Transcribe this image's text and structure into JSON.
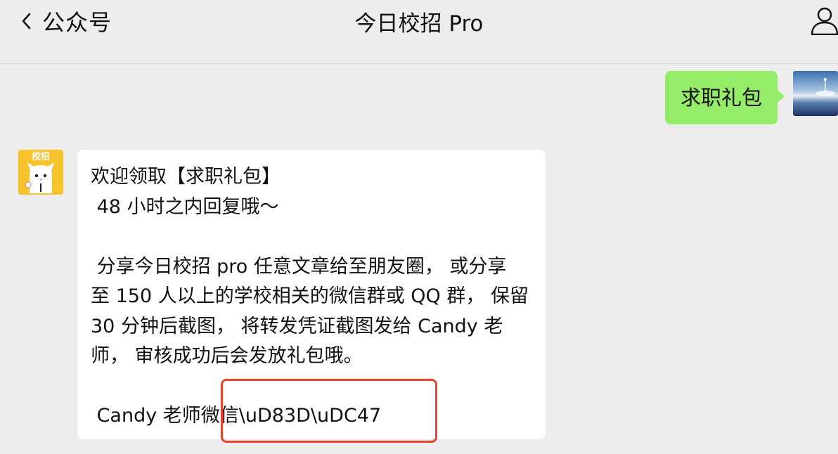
{
  "navbar": {
    "back_label": "公众号",
    "title": "今日校招 Pro"
  },
  "messages": {
    "outgoing_text": "求职礼包",
    "incoming_lines": [
      "欢迎领取【求职礼包】",
      " 48 小时之内回复哦～",
      "",
      " 分享今日校招 pro 任意文章给至朋友圈， 或分享",
      "至 150 人以上的学校相关的微信群或 QQ 群， 保留",
      "30 分钟后截图， 将转发凭证截图发给 Candy 老",
      "师， 审核成功后会发放礼包哦。",
      "",
      " Candy 老师微信\\uD83D\\uDC47"
    ],
    "bot_avatar_text": "校招"
  },
  "colors": {
    "background": "#ededed",
    "outgoing_bubble": "#95ec69",
    "incoming_bubble": "#ffffff",
    "annotation_border": "#e8432f",
    "avatar_yellow": "#f6c32b"
  },
  "icons": {
    "back": "chevron-left-icon",
    "profile": "person-icon"
  }
}
